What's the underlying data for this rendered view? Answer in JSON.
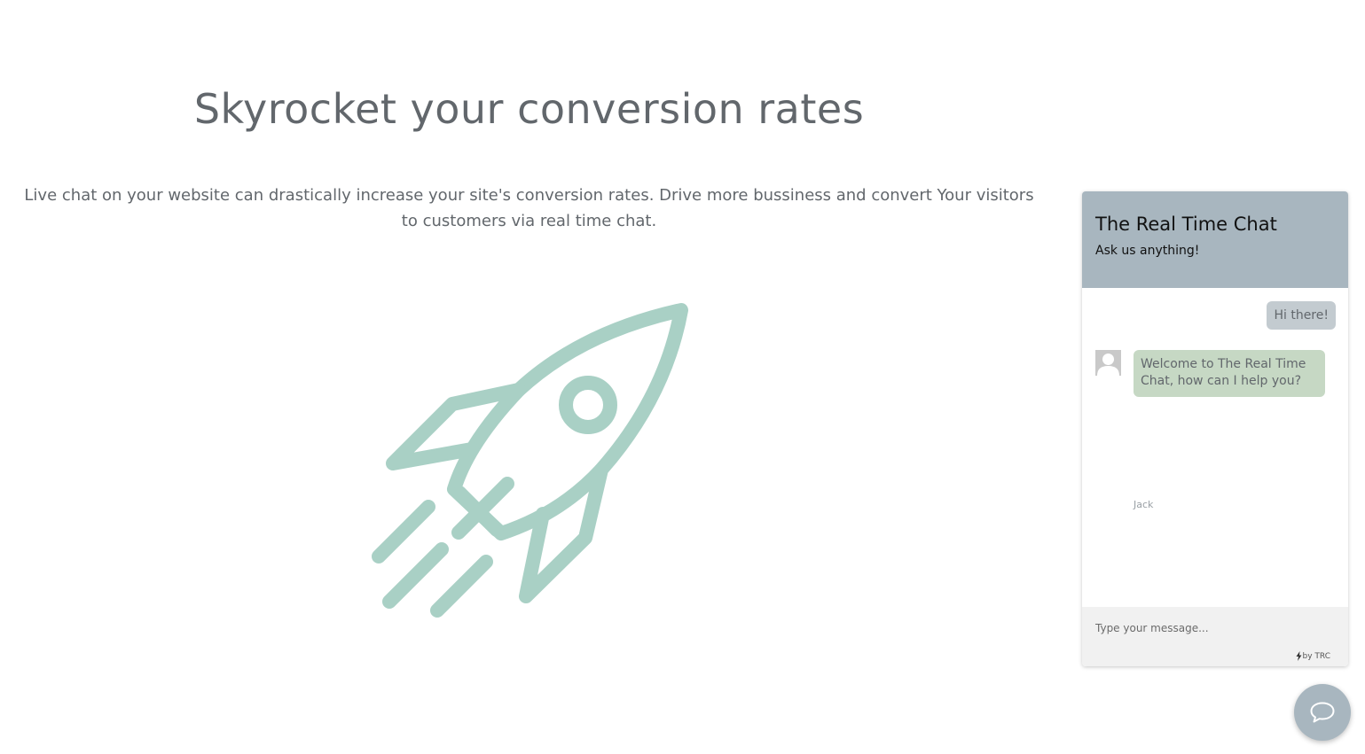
{
  "hero": {
    "title": "Skyrocket your conversion rates",
    "description": "Live chat on your website can drastically increase your site's conversion rates. Drive more bussiness and convert Your visitors to customers via real time chat.",
    "illustration_icon": "rocket-icon",
    "illustration_color": "#a9d0c5"
  },
  "chat": {
    "title": "The Real Time Chat",
    "subtitle": "Ask us anything!",
    "header_color": "#a8b6bf",
    "messages": [
      {
        "direction": "outgoing",
        "text": "Hi there!"
      },
      {
        "direction": "incoming",
        "text": "Welcome to The Real Time Chat, how can I help you?",
        "author": "Jack"
      }
    ],
    "input_placeholder": "Type your message...",
    "powered_by": "by TRC",
    "powered_icon": "bolt-icon",
    "launcher_icon": "chat-bubble-icon"
  }
}
